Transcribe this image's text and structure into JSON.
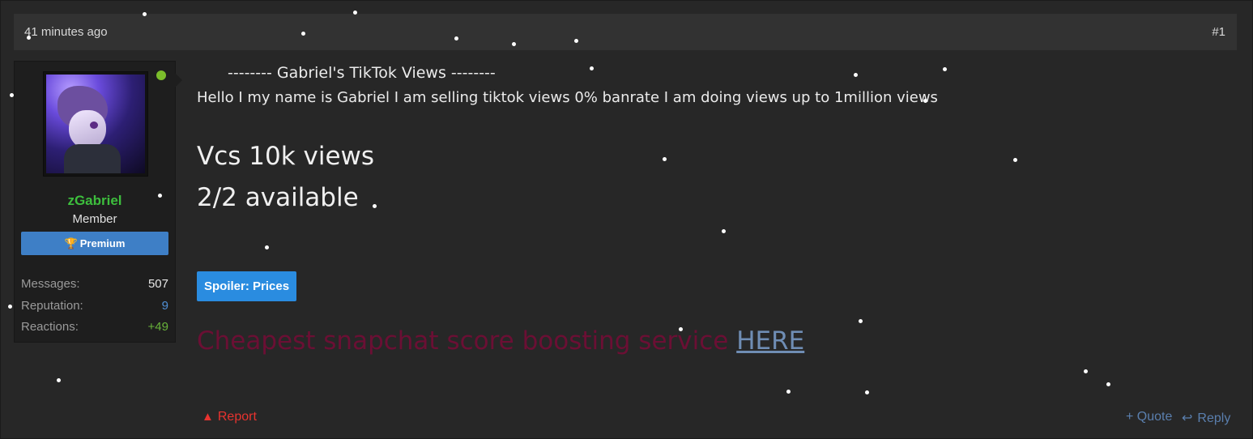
{
  "header": {
    "timestamp": "41 minutes ago",
    "post_number": "#1"
  },
  "user": {
    "username": "zGabriel",
    "title": "Member",
    "badge": "Premium",
    "badge_icon": "trophy-icon",
    "online": true,
    "stats": [
      {
        "label": "Messages:",
        "value": "507"
      },
      {
        "label": "Reputation:",
        "value": "9"
      },
      {
        "label": "Reactions:",
        "value": "+49"
      }
    ]
  },
  "post": {
    "title_line": "-------- Gabriel's TikTok Views --------",
    "intro": "Hello I my name is Gabriel I am selling tiktok views 0% banrate I am doing views up to 1million views",
    "line1": "Vcs 10k views",
    "line2": "2/2 available",
    "spoiler_label": "Spoiler: Prices",
    "promo_text": "Cheapest snapchat score boosting service",
    "promo_link": "HERE"
  },
  "actions": {
    "report": "Report",
    "report_icon": "warning-icon",
    "quote": "+ Quote",
    "reply": "Reply",
    "reply_icon": "reply-arrow-icon"
  },
  "colors": {
    "username": "#3dbe3d",
    "badge": "#3e7fc6",
    "online": "#7bbd2b",
    "spoiler": "#2a8ce0",
    "report": "#e8332f",
    "promo_text": "#6b0f34",
    "link": "#6f8db4"
  }
}
